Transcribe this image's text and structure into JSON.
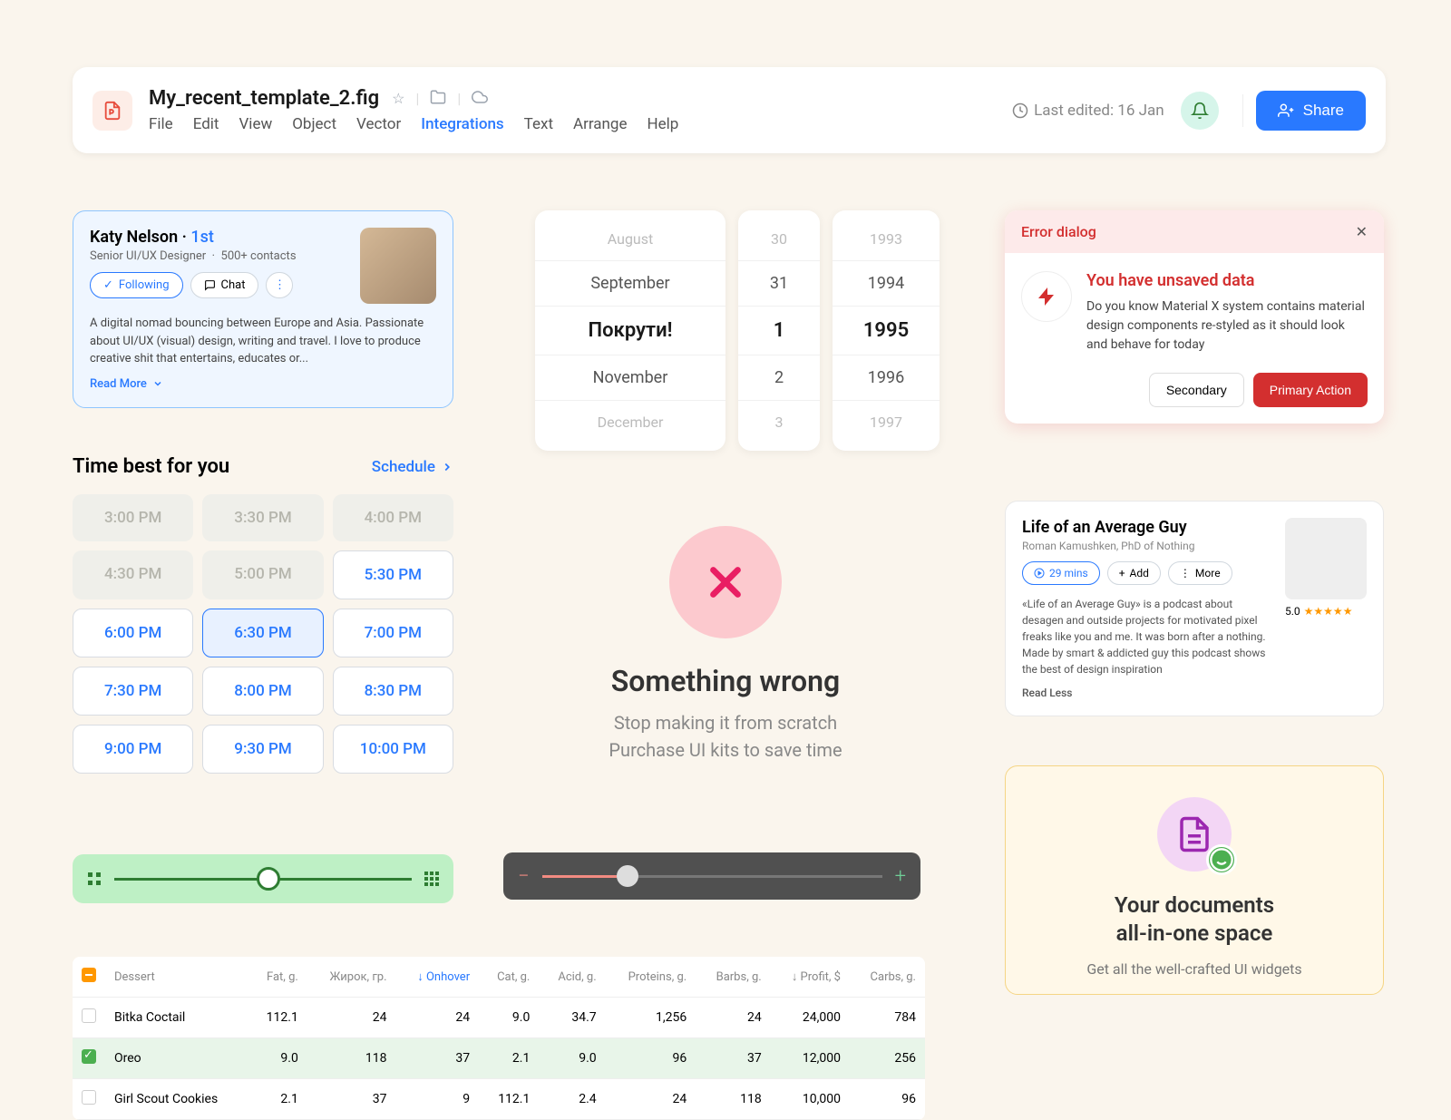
{
  "topbar": {
    "title": "My_recent_template_2.fig",
    "menu": [
      "File",
      "Edit",
      "View",
      "Object",
      "Vector",
      "Integrations",
      "Text",
      "Arrange",
      "Help"
    ],
    "active_menu_index": 5,
    "last_edited": "Last edited: 16 Jan",
    "share": "Share"
  },
  "profile": {
    "name": "Katy Nelson",
    "connection": "1st",
    "role": "Senior UI/UX Designer",
    "contacts": "500+ contacts",
    "following": "Following",
    "chat": "Chat",
    "desc": "A digital nomad bouncing between Europe and Asia. Passionate about UI/UX (visual) design, writing and travel. I love to produce creative shit that entertains, educates or...",
    "read_more": "Read More"
  },
  "time": {
    "title": "Time best for you",
    "schedule": "Schedule",
    "slots": [
      {
        "label": "3:00 PM",
        "state": "disabled"
      },
      {
        "label": "3:30 PM",
        "state": "disabled"
      },
      {
        "label": "4:00 PM",
        "state": "disabled"
      },
      {
        "label": "4:30 PM",
        "state": "disabled"
      },
      {
        "label": "5:00 PM",
        "state": "disabled"
      },
      {
        "label": "5:30 PM",
        "state": "avail"
      },
      {
        "label": "6:00 PM",
        "state": "avail"
      },
      {
        "label": "6:30 PM",
        "state": "selected"
      },
      {
        "label": "7:00 PM",
        "state": "avail"
      },
      {
        "label": "7:30 PM",
        "state": "avail"
      },
      {
        "label": "8:00 PM",
        "state": "avail"
      },
      {
        "label": "8:30 PM",
        "state": "avail"
      },
      {
        "label": "9:00 PM",
        "state": "avail"
      },
      {
        "label": "9:30 PM",
        "state": "avail"
      },
      {
        "label": "10:00 PM",
        "state": "avail"
      }
    ]
  },
  "date_picker": {
    "months": [
      "August",
      "September",
      "Покрути!",
      "November",
      "December"
    ],
    "days": [
      "30",
      "31",
      "1",
      "2",
      "3"
    ],
    "years": [
      "1993",
      "1994",
      "1995",
      "1996",
      "1997"
    ]
  },
  "error_block": {
    "title": "Something wrong",
    "sub1": "Stop making it from scratch",
    "sub2": "Purchase UI kits to save time"
  },
  "error_dialog": {
    "header": "Error dialog",
    "title": "You have unsaved data",
    "text": "Do you know Material X system contains material design components re-styled as it should look and behave for today",
    "secondary": "Secondary",
    "primary": "Primary Action"
  },
  "podcast": {
    "title": "Life of an Average Guy",
    "author": "Roman Kamushken, PhD of Nothing",
    "duration": "29 mins",
    "add": "Add",
    "more": "More",
    "desc": "«Life of an Average Guy» is a podcast about desagen and outside projects for motivated pixel freaks like you and me. It was born after a nothing. Made by smart & addicted guy this podcast shows the best of design inspiration",
    "read_less": "Read Less",
    "rating": "5.0"
  },
  "docs": {
    "title1": "Your documents",
    "title2": "all-in-one space",
    "sub": "Get all the well-crafted UI widgets"
  },
  "table": {
    "cols": [
      "Dessert",
      "Fat, g.",
      "Жирок, гр.",
      "Onhover",
      "Cat, g.",
      "Acid, g.",
      "Proteins, g.",
      "Barbs, g.",
      "Profit, $",
      "Carbs, g."
    ],
    "rows": [
      {
        "checked": false,
        "cells": [
          "Bitka Coctail",
          "112.1",
          "24",
          "24",
          "9.0",
          "34.7",
          "1,256",
          "24",
          "24,000",
          "784"
        ]
      },
      {
        "checked": true,
        "cells": [
          "Oreo",
          "9.0",
          "118",
          "37",
          "2.1",
          "9.0",
          "96",
          "37",
          "12,000",
          "256"
        ]
      },
      {
        "checked": false,
        "cells": [
          "Girl Scout Cookies",
          "2.1",
          "37",
          "9",
          "112.1",
          "2.4",
          "24",
          "118",
          "10,000",
          "96"
        ]
      }
    ]
  }
}
